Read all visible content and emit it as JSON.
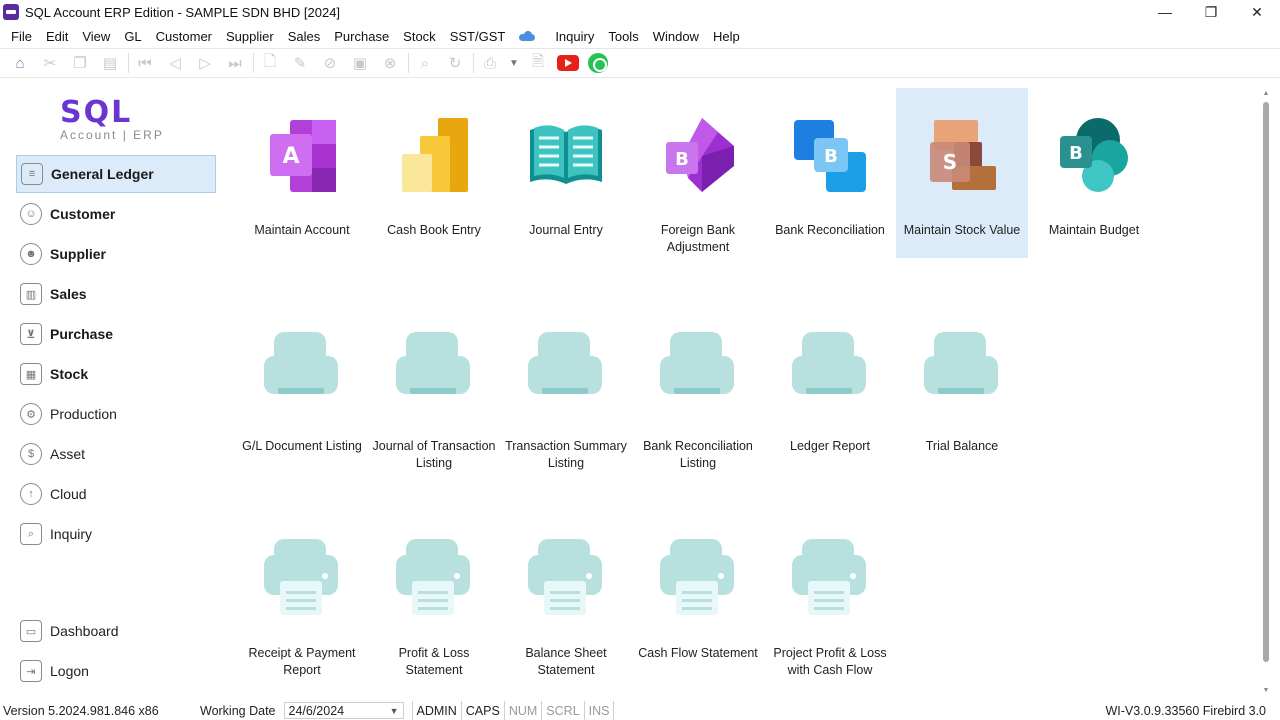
{
  "window": {
    "title": "SQL Account ERP Edition - SAMPLE SDN BHD [2024]",
    "minimize": "—",
    "maximize": "❐",
    "close": "✕"
  },
  "menu": [
    "File",
    "Edit",
    "View",
    "GL",
    "Customer",
    "Supplier",
    "Sales",
    "Purchase",
    "Stock",
    "SST/GST",
    "Inquiry",
    "Tools",
    "Window",
    "Help"
  ],
  "logo": {
    "name": "SQL",
    "sub": "Account | ERP"
  },
  "sidebar": {
    "items": [
      {
        "label": "General Ledger",
        "icon": "ledger-icon"
      },
      {
        "label": "Customer",
        "icon": "customer-icon"
      },
      {
        "label": "Supplier",
        "icon": "supplier-icon"
      },
      {
        "label": "Sales",
        "icon": "sales-chart-icon"
      },
      {
        "label": "Purchase",
        "icon": "cart-icon"
      },
      {
        "label": "Stock",
        "icon": "stock-icon"
      },
      {
        "label": "Production",
        "icon": "gear-icon"
      },
      {
        "label": "Asset",
        "icon": "dollar-icon"
      },
      {
        "label": "Cloud",
        "icon": "cloud-upload-icon"
      },
      {
        "label": "Inquiry",
        "icon": "inquiry-icon"
      }
    ],
    "dashboard": "Dashboard",
    "logon": "Logon"
  },
  "tiles_row1": [
    {
      "label": "Maintain Account",
      "letter": "A"
    },
    {
      "label": "Cash Book Entry"
    },
    {
      "label": "Journal Entry"
    },
    {
      "label": "Foreign Bank Adjustment",
      "letter": "B"
    },
    {
      "label": "Bank Reconciliation",
      "letter": "B"
    },
    {
      "label": "Maintain Stock Value",
      "letter": "S"
    },
    {
      "label": "Maintain Budget",
      "letter": "B"
    }
  ],
  "tiles_row2": [
    {
      "label": "G/L Document Listing"
    },
    {
      "label": "Journal of Transaction Listing"
    },
    {
      "label": "Transaction Summary Listing"
    },
    {
      "label": "Bank Reconciliation Listing"
    },
    {
      "label": "Ledger Report"
    },
    {
      "label": "Trial Balance"
    }
  ],
  "tiles_row3": [
    {
      "label": "Receipt & Payment Report"
    },
    {
      "label": "Profit & Loss Statement"
    },
    {
      "label": "Balance Sheet Statement"
    },
    {
      "label": "Cash Flow Statement"
    },
    {
      "label": "Project Profit & Loss with Cash Flow"
    }
  ],
  "status": {
    "version": "Version 5.2024.981.846 x86",
    "working_date_label": "Working Date",
    "working_date": "24/6/2024",
    "user": "ADMIN",
    "caps": "CAPS",
    "num": "NUM",
    "scrl": "SCRL",
    "ins": "INS",
    "db": "WI-V3.0.9.33560 Firebird 3.0"
  },
  "colors": {
    "selected_bg": "#dcebf9",
    "logo_purple": "#6b35d3",
    "printer_teal": "#b8e0df"
  }
}
